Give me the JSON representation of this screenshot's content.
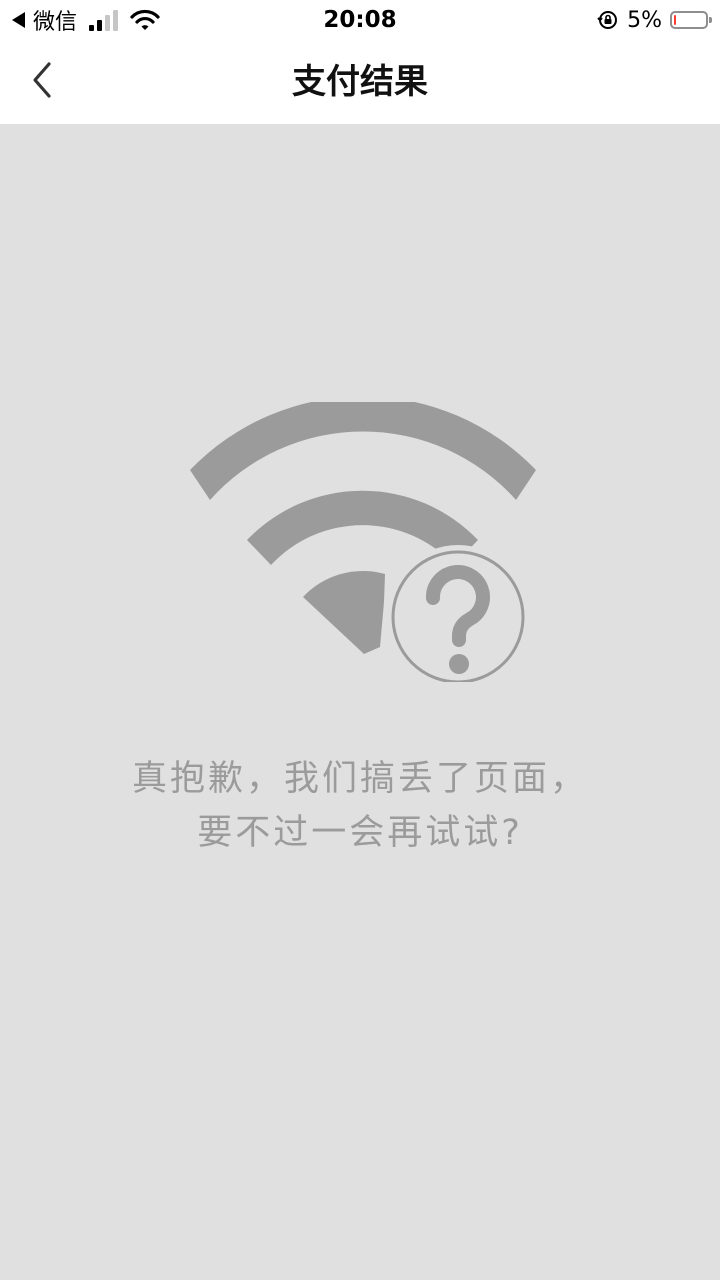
{
  "status_bar": {
    "back_app_label": "微信",
    "time": "20:08",
    "battery_text": "5%",
    "battery_level": 0.05,
    "battery_color": "#ff3b30"
  },
  "nav": {
    "title": "支付结果",
    "back_icon": "chevron-left-icon"
  },
  "content": {
    "background": "#e0e0e0",
    "illustration_icon": "wifi-question-icon",
    "message_line1": "真抱歉，我们搞丢了页面，",
    "message_line2": "要不过一会再试试?"
  }
}
